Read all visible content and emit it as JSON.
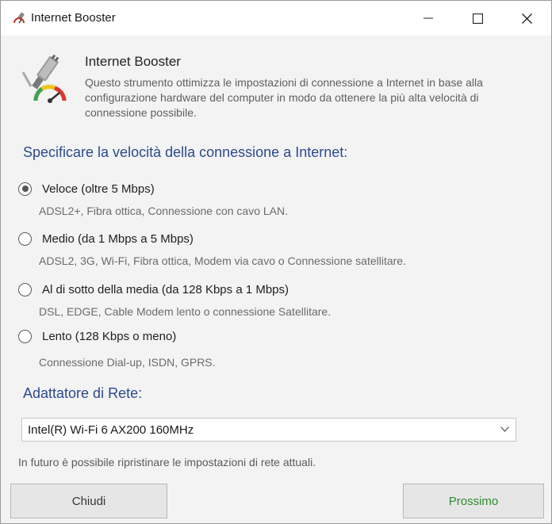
{
  "window": {
    "title": "Internet Booster"
  },
  "header": {
    "title": "Internet Booster",
    "description": "Questo strumento ottimizza le impostazioni di connessione a Internet in base alla configurazione hardware del computer in modo da ottenere la più alta velocità di connessione possibile."
  },
  "speed": {
    "title": "Specificare la velocità della connessione a Internet:",
    "selected_index": 0,
    "options": [
      {
        "label": "Veloce (oltre 5 Mbps)",
        "desc": "ADSL2+, Fibra ottica, Connessione con cavo LAN."
      },
      {
        "label": "Medio (da 1 Mbps a 5 Mbps)",
        "desc": "ADSL2, 3G, Wi-Fi, Fibra ottica, Modem via cavo o Connessione satellitare."
      },
      {
        "label": "Al di sotto della media (da 128 Kbps a 1 Mbps)",
        "desc": "DSL, EDGE, Cable Modem lento o connessione Satellitare."
      },
      {
        "label": "Lento (128 Kbps o meno)",
        "desc": "Connessione Dial-up, ISDN, GPRS."
      }
    ]
  },
  "adapter": {
    "title": "Adattatore di Rete:",
    "selected": "Intel(R) Wi-Fi 6 AX200 160MHz"
  },
  "note": "In futuro è possibile ripristinare le impostazioni di rete attuali.",
  "buttons": {
    "close": "Chiudi",
    "next": "Prossimo"
  },
  "colors": {
    "section_title": "#2c4a8c",
    "next_button_text": "#2e8b2e"
  },
  "icons": {
    "app": "plug-speedometer-icon",
    "minimize": "minimize-icon",
    "maximize": "maximize-icon",
    "close": "close-icon",
    "dropdown": "chevron-down-icon"
  }
}
